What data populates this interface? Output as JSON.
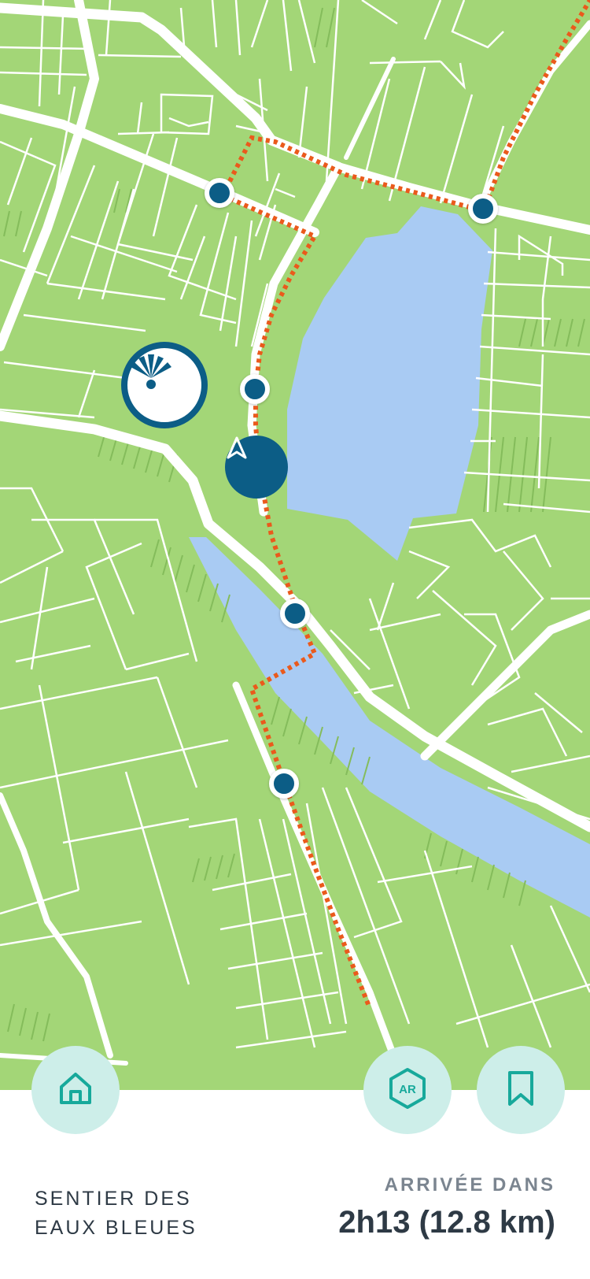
{
  "app": {
    "trail_name_line1": "SENTIER DES",
    "trail_name_line2": "EAUX BLEUES",
    "eta_label": "ARRIVÉE DANS",
    "eta_value": "2h13 (12.8 km)"
  },
  "buttons": {
    "home": {
      "icon": "home-icon"
    },
    "ar": {
      "icon": "ar-cube-icon",
      "label": "AR"
    },
    "bookmark": {
      "icon": "bookmark-icon"
    }
  },
  "map": {
    "land_color": "#a3d677",
    "water_color": "#a9cbf3",
    "road_color": "#ffffff",
    "route_color": "#ea5a1c",
    "marker_color": "#0c5d86",
    "landmark_icon": "fan-landmark-icon",
    "location_icon": "navigation-arrow-icon"
  },
  "colors": {
    "fab_bg": "#cdeee9",
    "fab_icon": "#17a99b",
    "text_dark": "#2e3a45",
    "text_muted": "#7b8590"
  }
}
